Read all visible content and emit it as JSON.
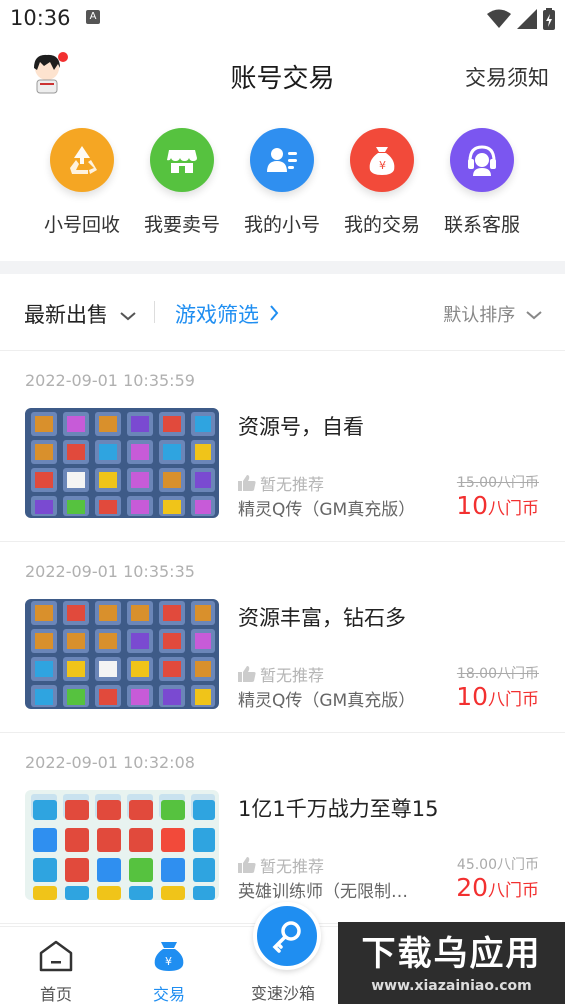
{
  "status": {
    "time": "10:36",
    "a_label": "A"
  },
  "header": {
    "title": "账号交易",
    "notice": "交易须知"
  },
  "quick_actions": [
    {
      "label": "小号回收",
      "icon": "recycle-icon",
      "color": "#f5a623"
    },
    {
      "label": "我要卖号",
      "icon": "store-icon",
      "color": "#56c23f"
    },
    {
      "label": "我的小号",
      "icon": "user-card-icon",
      "color": "#2f8ff0"
    },
    {
      "label": "我的交易",
      "icon": "money-bag-icon",
      "color": "#f24a3a"
    },
    {
      "label": "联系客服",
      "icon": "headset-icon",
      "color": "#7b56f0"
    }
  ],
  "filter": {
    "latest": "最新出售",
    "game_filter": "游戏筛选",
    "sort": "默认排序"
  },
  "items": [
    {
      "date": "2022-09-01 10:35:59",
      "name": "资源号，自看",
      "rec": "暂无推荐",
      "game": "精灵Q传（GM真充版）",
      "old": "15.00八门币",
      "price": "10",
      "unit": "八门币",
      "old_strike": true
    },
    {
      "date": "2022-09-01 10:35:35",
      "name": "资源丰富，钻石多",
      "rec": "暂无推荐",
      "game": "精灵Q传（GM真充版）",
      "old": "18.00八门币",
      "price": "10",
      "unit": "八门币",
      "old_strike": true
    },
    {
      "date": "2022-09-01 10:32:08",
      "name": "1亿1千万战力至尊15",
      "rec": "暂无推荐",
      "game": "英雄训练师（无限制…",
      "old": "45.00八门币",
      "price": "20",
      "unit": "八门币",
      "old_strike": false
    }
  ],
  "tabs": {
    "home": "首页",
    "trade": "交易",
    "sandbox": "变速沙箱"
  },
  "watermark": {
    "big": "下载乌应用",
    "small": "www.xiazainiao.com"
  },
  "colors": {
    "accent": "#1f8ef1",
    "price": "#f23030"
  }
}
